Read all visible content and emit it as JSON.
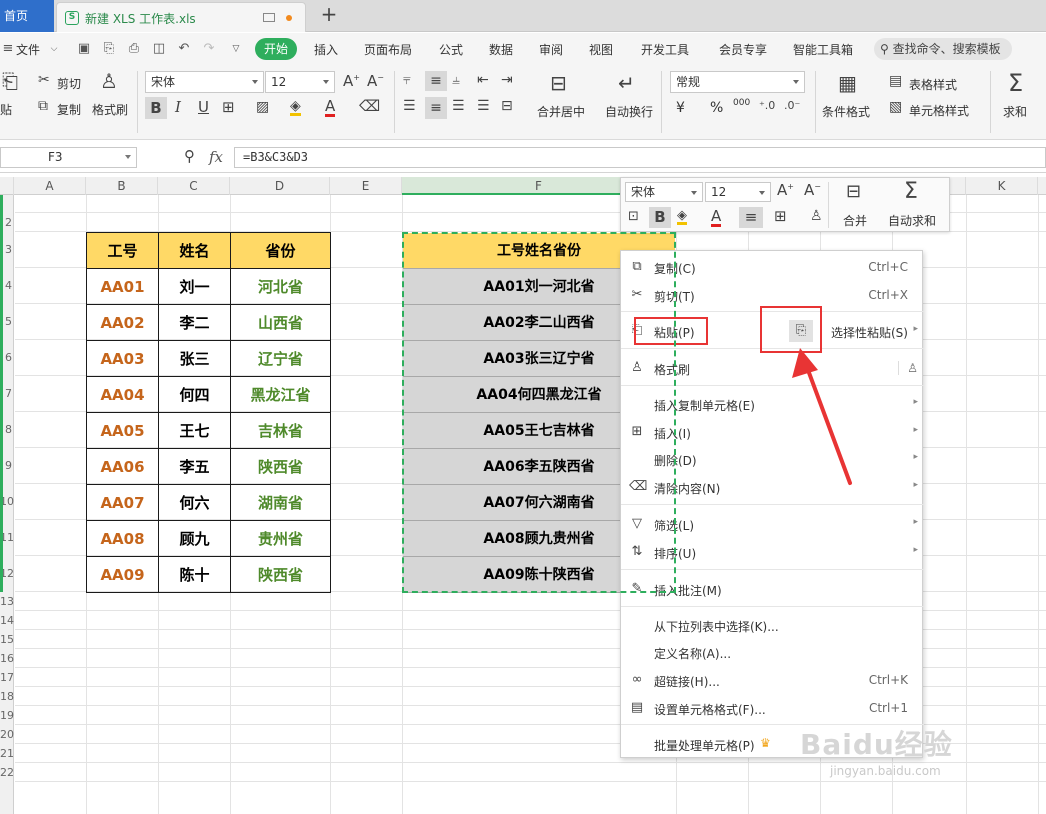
{
  "tabs": {
    "home": "首页",
    "document": "新建 XLS 工作表.xls",
    "new_tab": "+"
  },
  "menu": {
    "file": "文件",
    "items": [
      "开始",
      "插入",
      "页面布局",
      "公式",
      "数据",
      "审阅",
      "视图",
      "开发工具",
      "会员专享",
      "智能工具箱"
    ],
    "search_placeholder": "查找命令、搜索模板"
  },
  "ribbon": {
    "cut": "剪切",
    "paste_partial": "贴",
    "copy": "复制",
    "format_painter": "格式刷",
    "font_name": "宋体",
    "font_size": "12",
    "merge_center": "合并居中",
    "wrap_text": "自动换行",
    "number_format": "常规",
    "conditional_format": "条件格式",
    "table_style": "表格样式",
    "cell_style": "单元格样式",
    "sum": "求和",
    "currency": "¥",
    "percent": "%",
    "thousands": "000"
  },
  "formula_bar": {
    "cell_ref": "F3",
    "fx": "fx",
    "formula": "=B3&C3&D3"
  },
  "sheet": {
    "columns": [
      "A",
      "B",
      "C",
      "D",
      "E",
      "F",
      "K"
    ],
    "row_numbers": [
      "2",
      "3",
      "4",
      "5",
      "6",
      "7",
      "8",
      "9",
      "10",
      "11",
      "12",
      "13",
      "14",
      "15",
      "16",
      "17",
      "18",
      "19",
      "20",
      "21",
      "22"
    ],
    "table_headers": [
      "工号",
      "姓名",
      "省份"
    ],
    "rows": [
      {
        "id": "AA01",
        "name": "刘一",
        "province": "河北省"
      },
      {
        "id": "AA02",
        "name": "李二",
        "province": "山西省"
      },
      {
        "id": "AA03",
        "name": "张三",
        "province": "辽宁省"
      },
      {
        "id": "AA04",
        "name": "何四",
        "province": "黑龙江省"
      },
      {
        "id": "AA05",
        "name": "王七",
        "province": "吉林省"
      },
      {
        "id": "AA06",
        "name": "李五",
        "province": "陕西省"
      },
      {
        "id": "AA07",
        "name": "何六",
        "province": "湖南省"
      },
      {
        "id": "AA08",
        "name": "顾九",
        "province": "贵州省"
      },
      {
        "id": "AA09",
        "name": "陈十",
        "province": "陕西省"
      }
    ],
    "result_header": "工号姓名省份",
    "results": [
      "AA01刘一河北省",
      "AA02李二山西省",
      "AA03张三辽宁省",
      "AA04何四黑龙江省",
      "AA05王七吉林省",
      "AA06李五陕西省",
      "AA07何六湖南省",
      "AA08顾九贵州省",
      "AA09陈十陕西省"
    ]
  },
  "mini_toolbar": {
    "font": "宋体",
    "size": "12",
    "merge": "合并",
    "autosum": "自动求和"
  },
  "context_menu": {
    "copy": "复制(C)",
    "copy_shortcut": "Ctrl+C",
    "cut": "剪切(T)",
    "cut_shortcut": "Ctrl+X",
    "paste": "粘贴(P)",
    "paste_special": "选择性粘贴(S)",
    "format_painter": "格式刷",
    "insert_copied": "插入复制单元格(E)",
    "insert": "插入(I)",
    "delete": "删除(D)",
    "clear": "清除内容(N)",
    "filter": "筛选(L)",
    "sort": "排序(U)",
    "insert_comment": "插入批注(M)",
    "pick_list": "从下拉列表中选择(K)...",
    "define_name": "定义名称(A)...",
    "hyperlink": "超链接(H)...",
    "hyperlink_shortcut": "Ctrl+K",
    "format_cells": "设置单元格格式(F)...",
    "format_cells_shortcut": "Ctrl+1",
    "batch": "批量处理单元格(P)"
  },
  "colors": {
    "accent_green": "#2eae5d",
    "header_fill": "#ffd966",
    "id_text": "#c5651b",
    "province_text": "#4f8a2b",
    "annotation_red": "#e83434"
  },
  "watermark": {
    "brand": "Baidu经验",
    "url": "jingyan.baidu.com"
  }
}
